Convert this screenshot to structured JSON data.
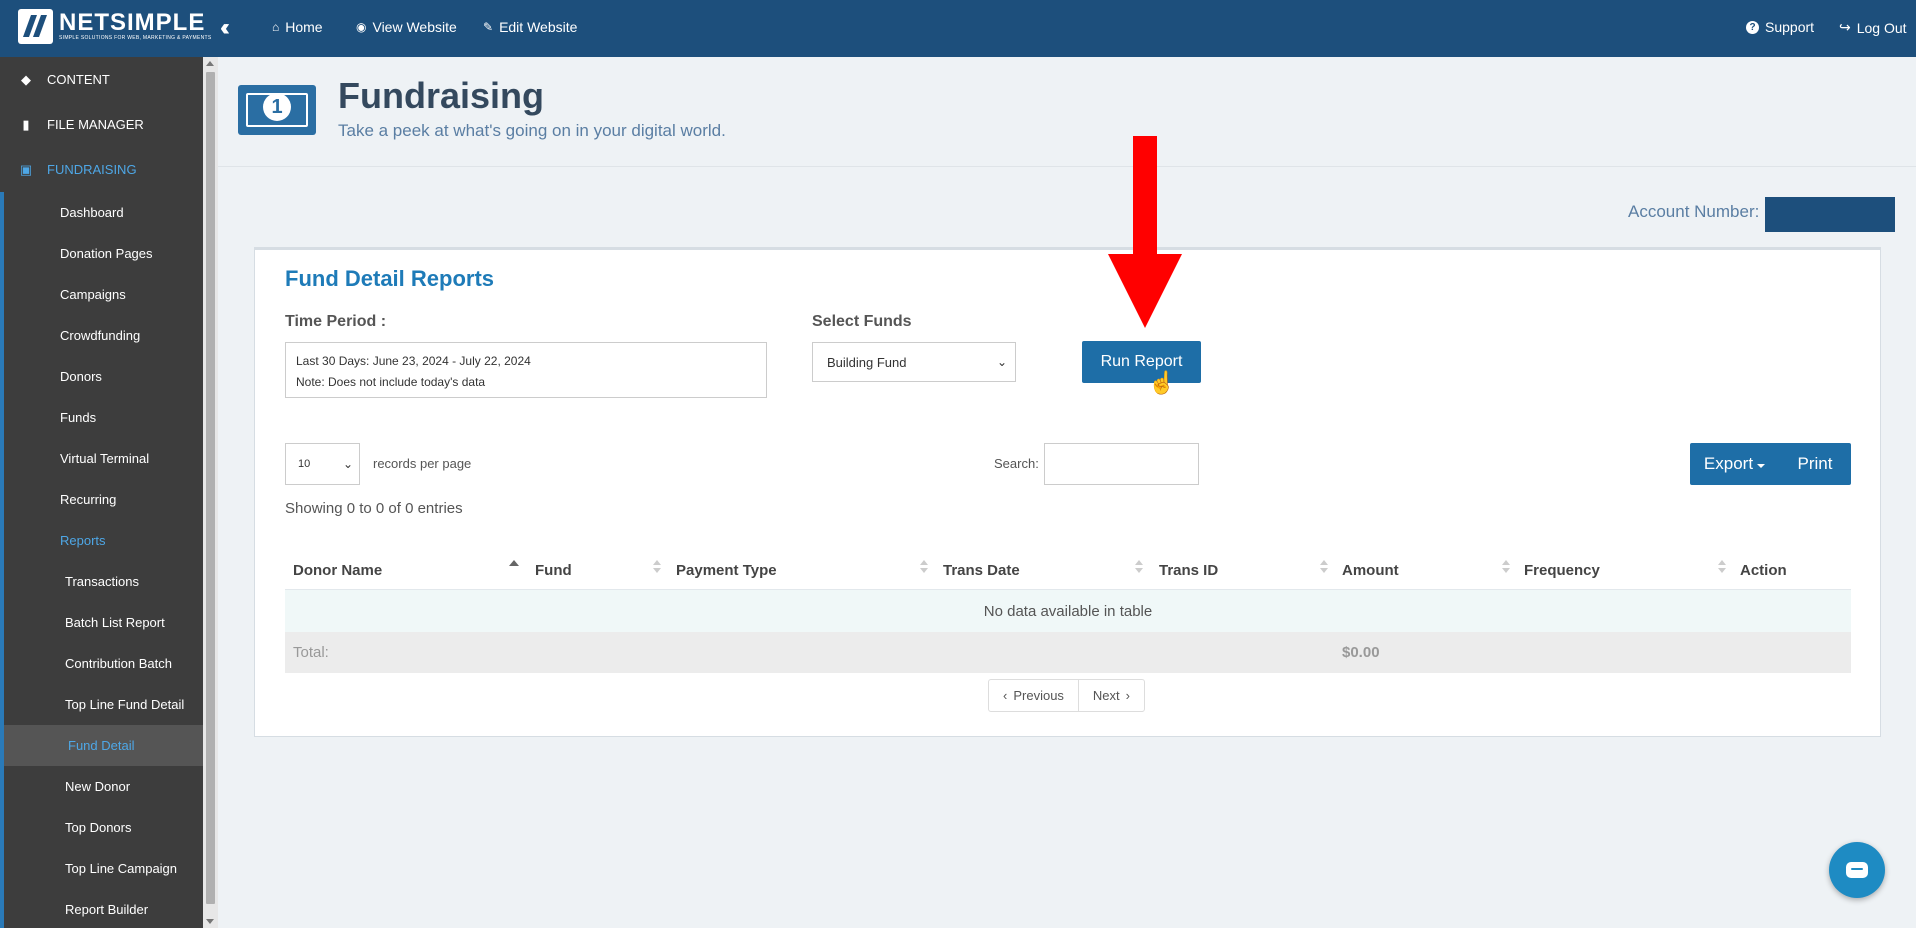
{
  "topbar": {
    "logo": {
      "name": "NETSIMPLE",
      "tagline": "SIMPLE SOLUTIONS FOR WEB, MARKETING & PAYMENTS"
    },
    "nav": [
      {
        "label": "Home",
        "icon": "home-icon"
      },
      {
        "label": "View Website",
        "icon": "eye-icon"
      },
      {
        "label": "Edit Website",
        "icon": "edit-icon"
      }
    ],
    "support": "Support",
    "logout": "Log Out"
  },
  "sidebar": {
    "sections": [
      {
        "label": "CONTENT",
        "icon": "diamond-icon"
      },
      {
        "label": "FILE MANAGER",
        "icon": "folder-icon"
      },
      {
        "label": "FUNDRAISING",
        "icon": "money-icon"
      }
    ],
    "items": [
      "Dashboard",
      "Donation Pages",
      "Campaigns",
      "Crowdfunding",
      "Donors",
      "Funds",
      "Virtual Terminal",
      "Recurring",
      "Reports"
    ],
    "report_items": [
      "Transactions",
      "Batch List Report",
      "Contribution Batch",
      "Top Line Fund Detail",
      "Fund Detail",
      "New Donor",
      "Top Donors",
      "Top Line Campaign",
      "Report Builder"
    ]
  },
  "header": {
    "title": "Fundraising",
    "subtitle": "Take a peek at what's going on in your digital world.",
    "icon_glyph": "1"
  },
  "account": {
    "label": "Account Number:"
  },
  "report": {
    "title": "Fund Detail Reports",
    "time_period_label": "Time Period :",
    "period_line1": "Last 30 Days: June 23, 2024 - July 22, 2024",
    "period_line2": "Note: Does not include today's data",
    "select_funds_label": "Select Funds",
    "selected_fund": "Building Fund",
    "run_button": "Run Report",
    "page_size": "10",
    "records_per_page": "records per page",
    "search_label": "Search:",
    "export": "Export",
    "print": "Print",
    "showing": "Showing 0 to 0 of 0 entries",
    "columns": [
      "Donor Name",
      "Fund",
      "Payment Type",
      "Trans Date",
      "Trans ID",
      "Amount",
      "Frequency",
      "Action"
    ],
    "no_data": "No data available in table",
    "total_label": "Total:",
    "total_amount": "$0.00",
    "previous": "Previous",
    "next": "Next"
  },
  "colors": {
    "topbar": "#1d4f7c",
    "sidebar": "#3d3d3d",
    "accent": "#1e6ea7",
    "annotation": "#ff0000"
  }
}
